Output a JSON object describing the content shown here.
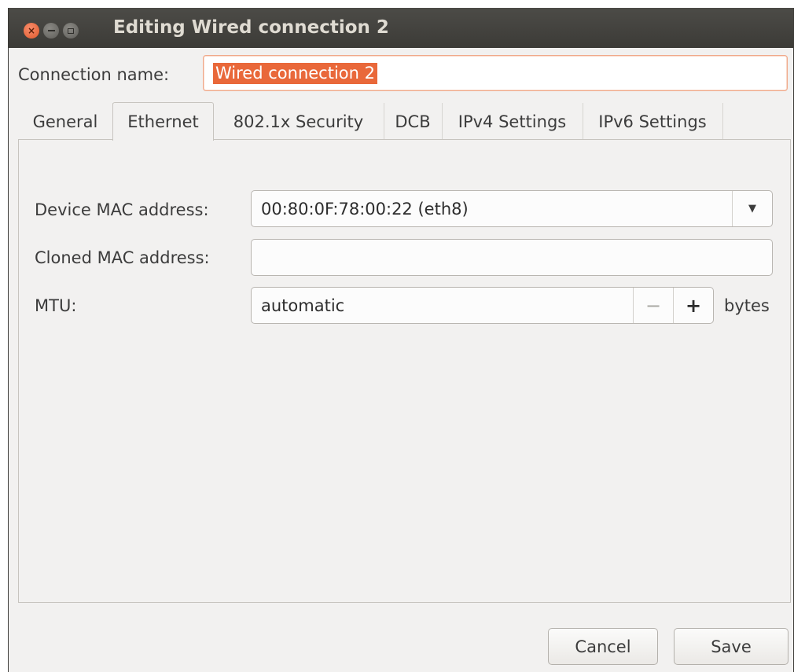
{
  "window": {
    "title": "Editing Wired connection 2"
  },
  "connection": {
    "label": "Connection name:",
    "value": "Wired connection 2"
  },
  "tabs": [
    {
      "label": "General"
    },
    {
      "label": "Ethernet",
      "active": true
    },
    {
      "label": "802.1x Security"
    },
    {
      "label": "DCB"
    },
    {
      "label": "IPv4 Settings"
    },
    {
      "label": "IPv6 Settings"
    }
  ],
  "ethernet": {
    "device_mac_label": "Device MAC address:",
    "device_mac_value": "00:80:0F:78:00:22 (eth8)",
    "cloned_mac_label": "Cloned MAC address:",
    "cloned_mac_value": "",
    "mtu_label": "MTU:",
    "mtu_value": "automatic",
    "mtu_minus": "−",
    "mtu_plus": "+",
    "mtu_unit": "bytes"
  },
  "buttons": {
    "cancel": "Cancel",
    "save": "Save"
  },
  "colors": {
    "accent": "#e9683a",
    "titlebar": "#3c3b37",
    "window_bg": "#f2f1f0"
  }
}
